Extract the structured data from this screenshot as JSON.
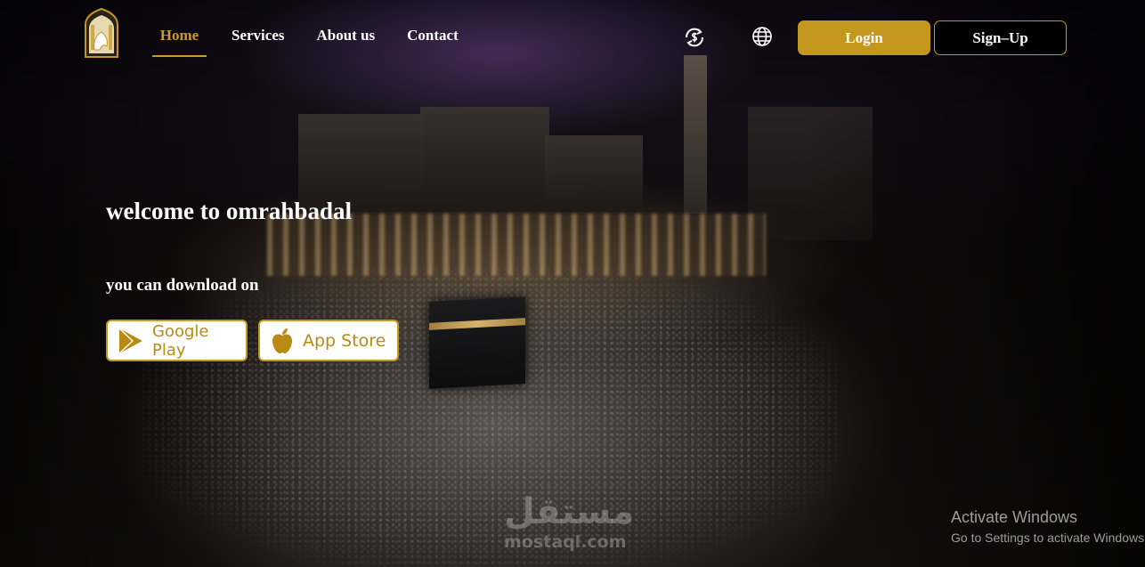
{
  "nav": {
    "items": [
      {
        "label": "Home",
        "active": true
      },
      {
        "label": "Services",
        "active": false
      },
      {
        "label": "About us",
        "active": false
      },
      {
        "label": "Contact",
        "active": false
      }
    ],
    "currency_icon": "currency-exchange-icon",
    "language_icon": "globe-icon",
    "login_label": "Login",
    "signup_label": "Sign–Up"
  },
  "hero": {
    "welcome": "welcome to omrahbadal",
    "download_label": "you can download on",
    "google_play_label": "Google Play",
    "app_store_label": "App Store"
  },
  "watermark": {
    "arabic": "مستقل",
    "latin": "mostaql.com"
  },
  "windows_activation": {
    "title": "Activate Windows",
    "subtitle": "Go to Settings to activate Windows."
  },
  "colors": {
    "accent": "#c3961d",
    "active_nav": "#c89b2b"
  }
}
